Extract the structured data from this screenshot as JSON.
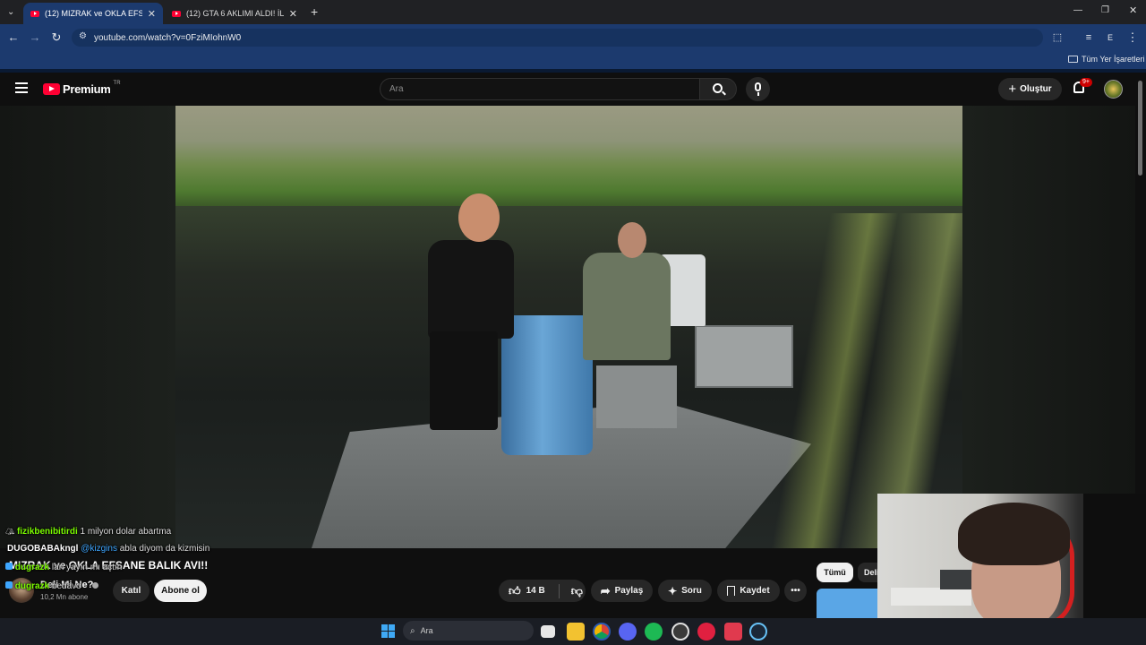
{
  "browser": {
    "tabs": [
      {
        "label": "(12) MIZRAK ve OKLA EFSANE B",
        "active": true
      },
      {
        "label": "(12) GTA 6 AKLIMI ALDI! İLK OY",
        "active": false
      }
    ],
    "url": "youtube.com/watch?v=0FziMIohnW0",
    "bookmarks_label": "Tüm Yer İşaretleri",
    "profile_initial": "E"
  },
  "youtube": {
    "logo_text": "Premium",
    "region": "TR",
    "search_placeholder": "Ara",
    "create_label": "Oluştur",
    "notifications": "9+"
  },
  "video": {
    "title": "MIZRAK ve OKLA EFSANE BALIK AVI!!",
    "channel_name": "Deli Mi Ne?",
    "subscribers": "10,2 Mn abone",
    "join_label": "Katıl",
    "subscribe_label": "Abone ol",
    "likes": "14 B",
    "share_label": "Paylaş",
    "ask_label": "Soru",
    "save_label": "Kaydet",
    "chip_all": "Tümü",
    "chip_partial": "Deli"
  },
  "chat": [
    {
      "user": "fizikbenibitirdi",
      "message": "1 milyon dolar abartma",
      "color": "#7cfc00"
    },
    {
      "user": "DUGOBABAkngl",
      "mention": "@kizgins",
      "message": "abla diyom da kizmisin",
      "color": "#ffffff"
    },
    {
      "user": "dugrazk",
      "message": "lan yayın mı açtın",
      "color": "#7cfc00"
    },
    {
      "user": "dugrazk",
      "message": "bedavo",
      "color": "#7cfc00"
    }
  ],
  "taskbar": {
    "search_placeholder": "Ara"
  },
  "colors": {
    "tab_active": "#1c3a6e",
    "youtube_red": "#ff0033",
    "chat_user_green": "#7cfc00",
    "mention_blue": "#3ea6ff"
  }
}
